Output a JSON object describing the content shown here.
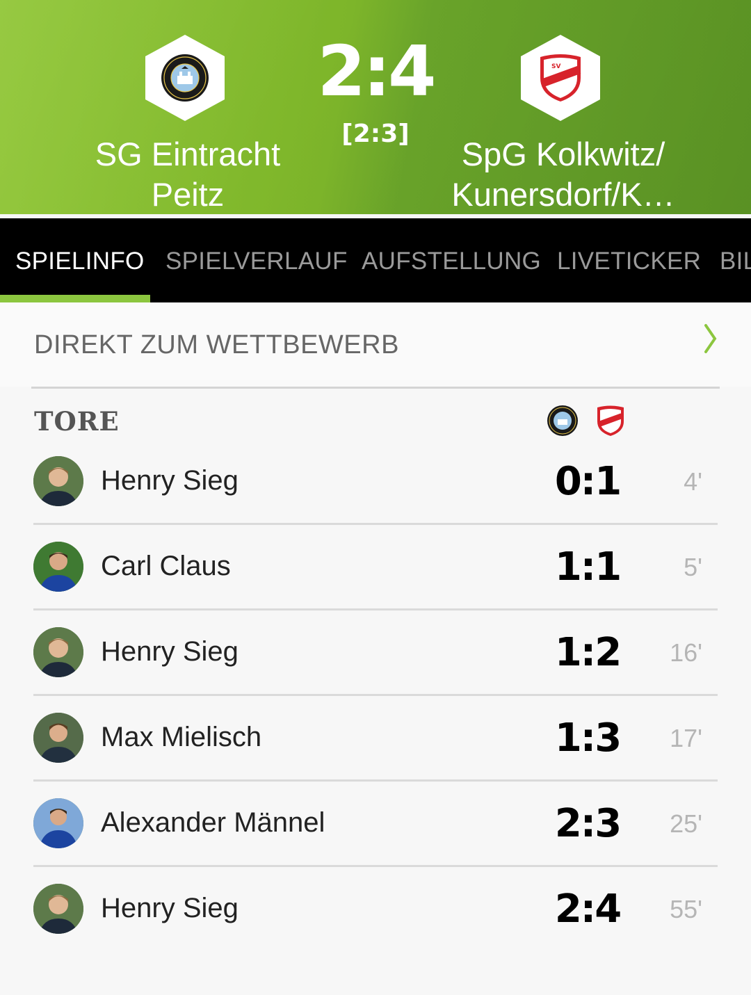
{
  "match": {
    "home_team": "SG Eintracht Peitz",
    "away_team": "SpG Kolkwitz/ Kunersdorf/K…",
    "score": "2:4",
    "halftime": "[2:3]",
    "home_crest_text": "SPORTVEREIN 1924 e.V. SG EINTRACHT PEITZ",
    "away_crest_text": "SV KOLKWITZ 1896"
  },
  "tabs": [
    {
      "label": "SPIELINFO",
      "active": true
    },
    {
      "label": "SPIELVERLAUF",
      "active": false
    },
    {
      "label": "AUFSTELLUNG",
      "active": false
    },
    {
      "label": "LIVETICKER",
      "active": false
    },
    {
      "label": "BIL",
      "active": false
    }
  ],
  "wettbewerb": {
    "label": "DIREKT ZUM WETTBEWERB",
    "icon": "chevron-right-icon"
  },
  "tore": {
    "title": "TORE",
    "goals": [
      {
        "player": "Henry Sieg",
        "score": "0:1",
        "minute": "4'"
      },
      {
        "player": "Carl Claus",
        "score": "1:1",
        "minute": "5'"
      },
      {
        "player": "Henry Sieg",
        "score": "1:2",
        "minute": "16'"
      },
      {
        "player": "Max Mielisch",
        "score": "1:3",
        "minute": "17'"
      },
      {
        "player": "Alexander Männel",
        "score": "2:3",
        "minute": "25'"
      },
      {
        "player": "Henry Sieg",
        "score": "2:4",
        "minute": "55'"
      }
    ]
  },
  "colors": {
    "accent": "#8cc63f",
    "header_green": "#7db52a",
    "tabbar": "#000000"
  }
}
